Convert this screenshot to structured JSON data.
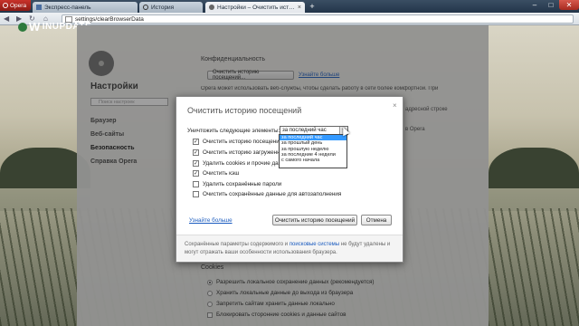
{
  "browser": {
    "menu_label": "Opera",
    "tabs": [
      {
        "label": "Экспресс-панель",
        "active": false
      },
      {
        "label": "История",
        "active": false
      },
      {
        "label": "Настройки – Очистить ист…",
        "active": true
      }
    ],
    "new_tab_label": "+",
    "window_controls": {
      "minimize": "–",
      "maximize": "□",
      "close": "✕"
    },
    "address": "settings/clearBrowserData",
    "nav": {
      "back": "◀",
      "forward": "▶",
      "reload": "↻",
      "home": "⌂"
    }
  },
  "watermark": {
    "prefix": "W",
    "text": "INUPDATE"
  },
  "settings": {
    "title": "Настройки",
    "search_placeholder": "Поиск настроек",
    "nav": [
      "Браузер",
      "Веб-сайты",
      "Безопасность",
      "Справка Opera"
    ],
    "privacy_heading": "Конфиденциальность",
    "clear_history_button": "Очистить историю посещений...",
    "learn_more": "Узнайте больше",
    "opera_services_text": "Opera может использовать веб-службы, чтобы сделать работу в сети более комфортной. При",
    "address_bar_fragment": "адресной строке",
    "opera_fragment": "в Opera",
    "cookies_heading": "Cookies",
    "cookie_options": [
      {
        "label": "Разрешить локальное сохранение данных (рекомендуется)",
        "selected": true
      },
      {
        "label": "Хранить локальные данные до выхода из браузера",
        "selected": false
      },
      {
        "label": "Запретить сайтам хранить данные локально",
        "selected": false
      }
    ],
    "block_third_party": "Блокировать сторонние cookies и данные сайтов"
  },
  "dialog": {
    "title": "Очистить историю посещений",
    "close": "×",
    "period_label": "Уничтожить следующие элементы:",
    "period_value": "за последний час",
    "items": [
      {
        "label": "Очистить историю посещений",
        "checked": true
      },
      {
        "label": "Очистить историю загруженных файлов",
        "checked": true
      },
      {
        "label": "Удалить cookies и прочие данные сайтов",
        "checked": true
      },
      {
        "label": "Очистить кэш",
        "checked": true
      },
      {
        "label": "Удалить сохранённые пароли",
        "checked": false
      },
      {
        "label": "Очистить сохранённые данные для автозаполнения",
        "checked": false
      }
    ],
    "learn_more": "Узнайте больше",
    "confirm_button": "Очистить историю посещений",
    "cancel_button": "Отмена",
    "footer_before": "Сохранённые параметры содержимого и ",
    "footer_link": "поисковые системы",
    "footer_after": " не будут удалены и могут отражать ваши особенности использования браузера.",
    "dropdown_options": [
      {
        "label": "за последний час",
        "selected": true
      },
      {
        "label": "за прошлый день",
        "selected": false
      },
      {
        "label": "за прошлую неделю",
        "selected": false
      },
      {
        "label": "за последние 4 недели",
        "selected": false
      },
      {
        "label": "с самого начала",
        "selected": false
      }
    ]
  }
}
